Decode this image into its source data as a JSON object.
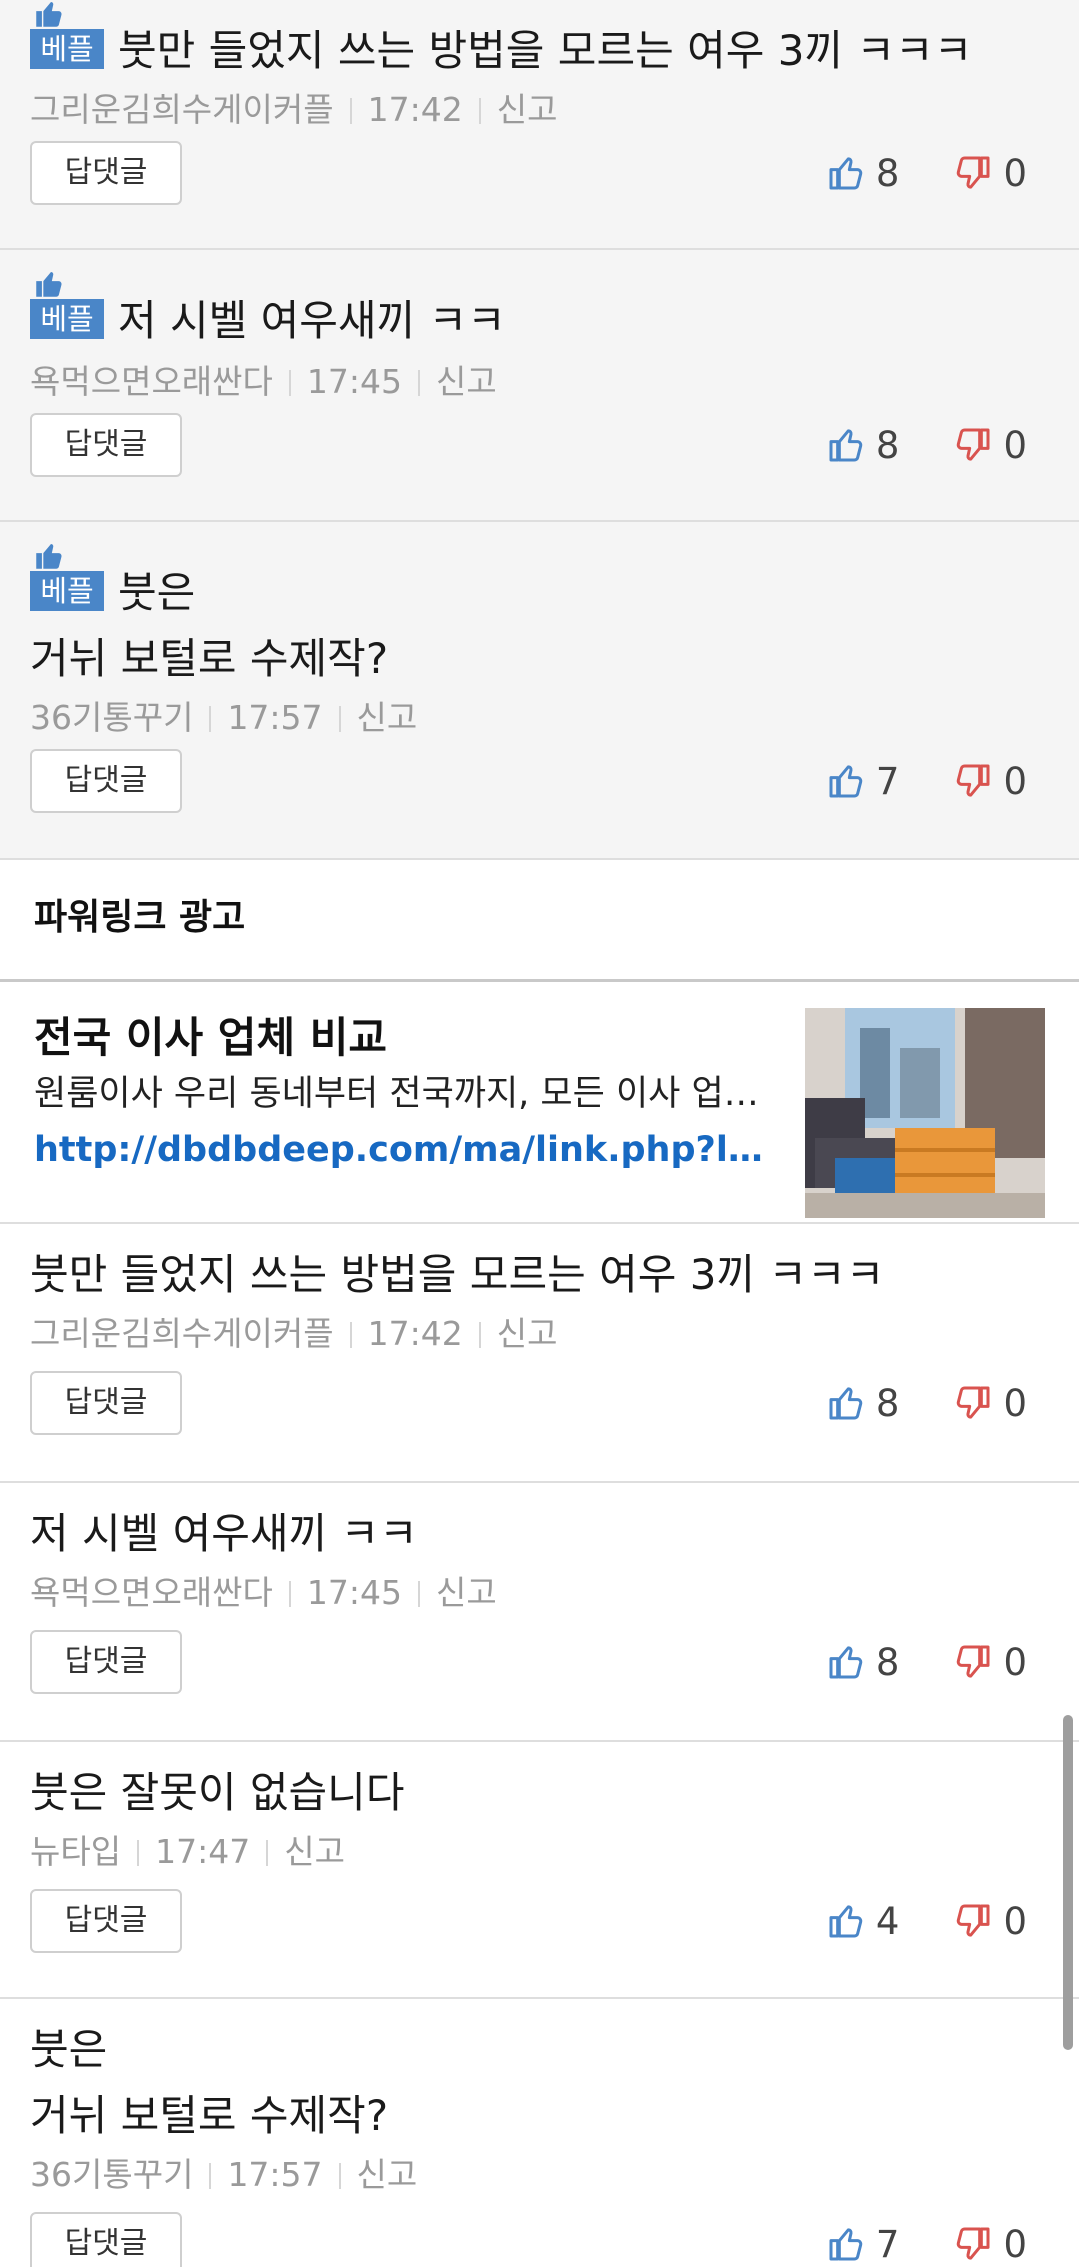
{
  "best_comments": [
    {
      "badge": "베플",
      "lines": [
        "붓만 들었지 쓰는 방법을 모르는 여우 3끼 ㅋㅋㅋ"
      ],
      "author": "그리운김희수게이커플",
      "time": "17:42",
      "report": "신고",
      "reply_label": "답댓글",
      "likes": "8",
      "dislikes": "0"
    },
    {
      "badge": "베플",
      "lines": [
        "저 시벨 여우새끼 ㅋㅋ"
      ],
      "author": "욕먹으면오래싼다",
      "time": "17:45",
      "report": "신고",
      "reply_label": "답댓글",
      "likes": "8",
      "dislikes": "0"
    },
    {
      "badge": "베플",
      "lines": [
        "붓은",
        "거뉘 보털로 수제작?"
      ],
      "author": "36기통꾸기",
      "time": "17:57",
      "report": "신고",
      "reply_label": "답댓글",
      "likes": "7",
      "dislikes": "0"
    }
  ],
  "ad_section": {
    "header": "파워링크 광고",
    "title": "전국 이사 업체 비교",
    "description": "원룸이사 우리 동네부터 전국까지, 모든 이사 업체 비교",
    "link": "http://dbdbdeep.com/ma/link.php?ln=..."
  },
  "comments": [
    {
      "lines": [
        "붓만 들었지 쓰는 방법을 모르는 여우 3끼 ㅋㅋㅋ"
      ],
      "author": "그리운김희수게이커플",
      "time": "17:42",
      "report": "신고",
      "reply_label": "답댓글",
      "likes": "8",
      "dislikes": "0"
    },
    {
      "lines": [
        "저 시벨 여우새끼 ㅋㅋ"
      ],
      "author": "욕먹으면오래싼다",
      "time": "17:45",
      "report": "신고",
      "reply_label": "답댓글",
      "likes": "8",
      "dislikes": "0"
    },
    {
      "lines": [
        "붓은 잘못이 없습니다"
      ],
      "author": "뉴타입",
      "time": "17:47",
      "report": "신고",
      "reply_label": "답댓글",
      "likes": "4",
      "dislikes": "0"
    },
    {
      "lines": [
        "붓은",
        "거뉘 보털로 수제작?"
      ],
      "author": "36기통꾸기",
      "time": "17:57",
      "report": "신고",
      "reply_label": "답댓글",
      "likes": "7",
      "dislikes": "0"
    }
  ],
  "colors": {
    "accent": "#4a86c8",
    "link": "#1769c2",
    "dislike": "#d9534f"
  }
}
